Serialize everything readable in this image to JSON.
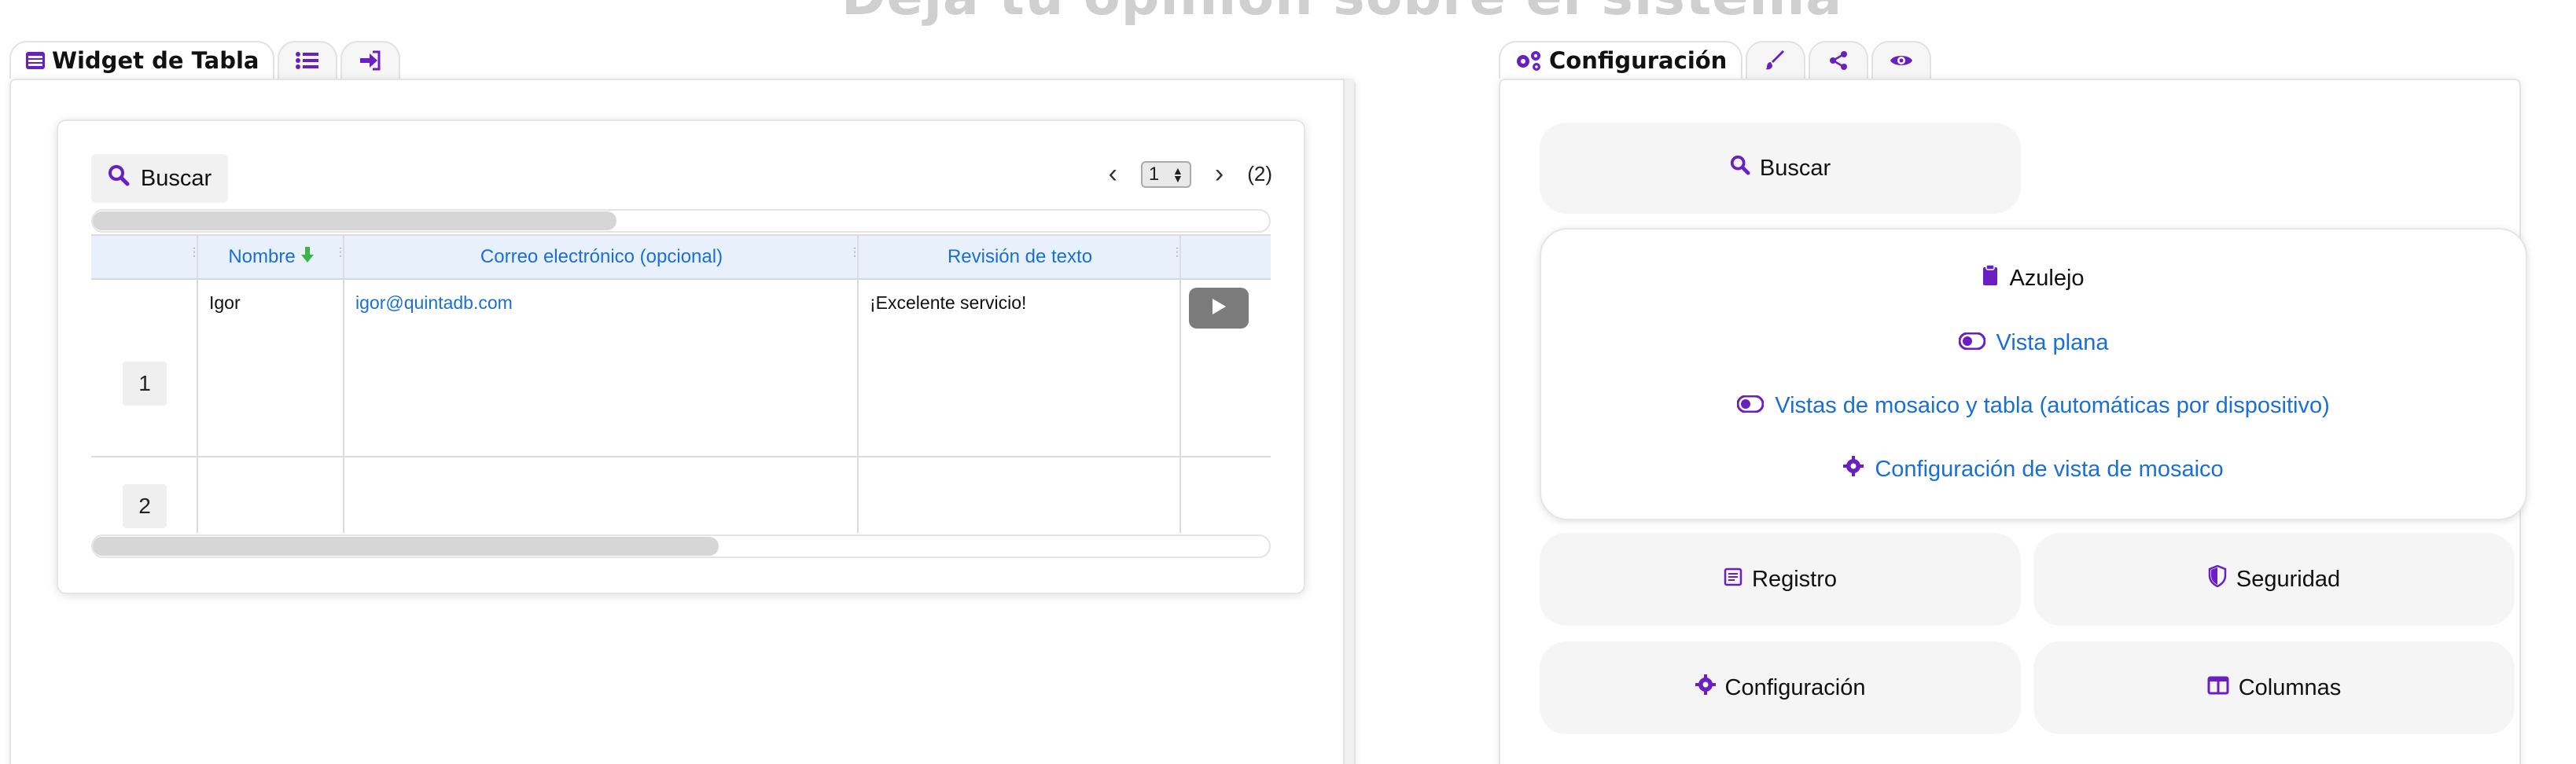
{
  "page": {
    "heading": "Deja tu opinión sobre el sistema"
  },
  "colors": {
    "accent": "#6a1fc2",
    "link": "#1a6fd6",
    "header_bg": "#e8f1fb"
  },
  "left_tabs": {
    "active_label": "Widget de Tabla",
    "active_icon": "table-icon",
    "icon_tabs": [
      "list-icon",
      "sign-in-icon"
    ]
  },
  "table_widget": {
    "search_label": "Buscar",
    "pagination": {
      "page": "1",
      "total": "(2)",
      "prev_icon": "chevron-left-icon",
      "next_icon": "chevron-right-icon"
    },
    "columns": [
      {
        "label": "Nombre",
        "sort": "descending"
      },
      {
        "label": "Correo electrónico (opcional)"
      },
      {
        "label": "Revisión de texto"
      }
    ],
    "rows": [
      {
        "num": "1",
        "name": "Igor",
        "email": "igor@quintadb.com",
        "review": "¡Excelente servicio!"
      },
      {
        "num": "2",
        "name": "",
        "email": "",
        "review": ""
      }
    ]
  },
  "right_tabs": {
    "active_label": "Configuración",
    "active_icon": "gears-icon",
    "icon_tabs": [
      "brush-icon",
      "share-icon",
      "eye-icon"
    ]
  },
  "settings": {
    "search_label": "Buscar",
    "tile": {
      "title": "Azulejo",
      "options": [
        {
          "label": "Vista plana",
          "icon": "toggle-icon"
        },
        {
          "label": "Vistas de mosaico y tabla (automáticas por dispositivo)",
          "icon": "toggle-icon"
        },
        {
          "label": "Configuración de vista de mosaico",
          "icon": "gear-icon"
        }
      ]
    },
    "buttons": {
      "log": "Registro",
      "security": "Seguridad",
      "config": "Configuración",
      "columns": "Columnas"
    }
  }
}
